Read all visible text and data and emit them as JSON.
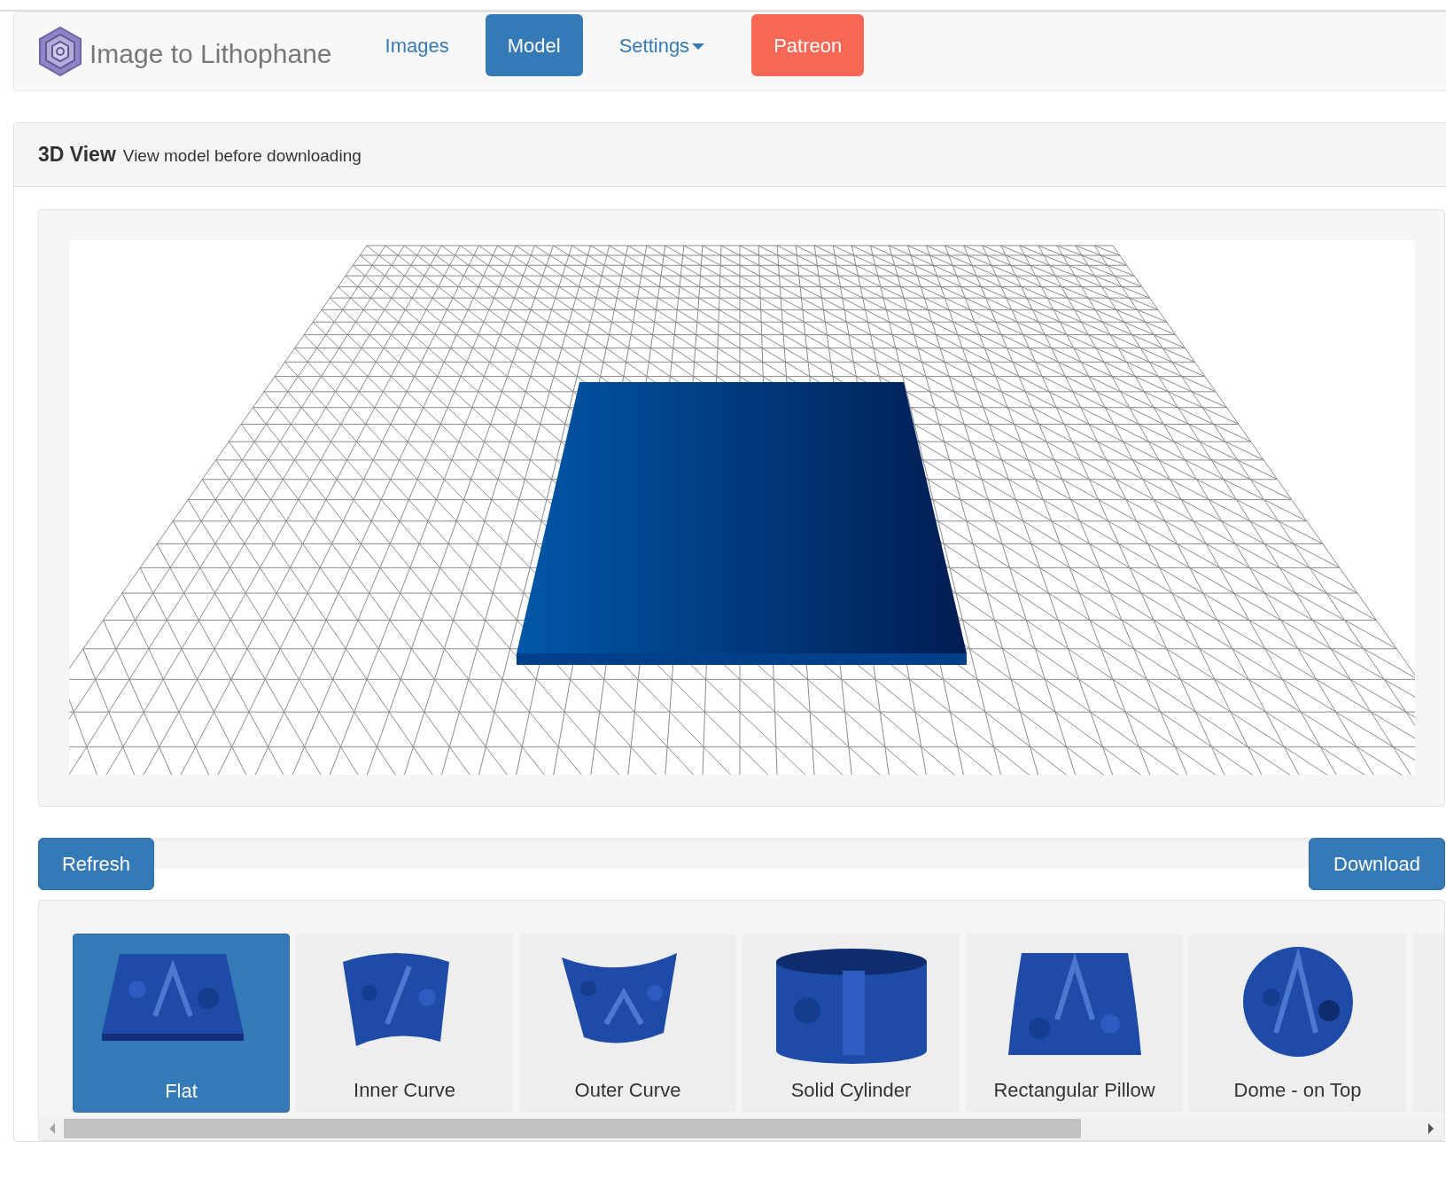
{
  "brand": {
    "title": "Image to Lithophane"
  },
  "nav": [
    {
      "label": "Images",
      "kind": "link",
      "selected": false
    },
    {
      "label": "Model",
      "kind": "link",
      "selected": true
    },
    {
      "label": "Settings",
      "kind": "dropdown",
      "selected": false
    },
    {
      "label": "Patreon",
      "kind": "patreon",
      "selected": false
    }
  ],
  "panel": {
    "title": "3D View",
    "subtitle": "View model before downloading"
  },
  "actions": {
    "refresh": "Refresh",
    "download": "Download",
    "progress": {
      "level": 0
    }
  },
  "shapes": [
    {
      "label": "Flat",
      "selected": true
    },
    {
      "label": "Inner Curve",
      "selected": false
    },
    {
      "label": "Outer Curve",
      "selected": false
    },
    {
      "label": "Solid Cylinder",
      "selected": false
    },
    {
      "label": "Rectangular Pillow",
      "selected": false
    },
    {
      "label": "Dome - on Top",
      "selected": false
    }
  ]
}
